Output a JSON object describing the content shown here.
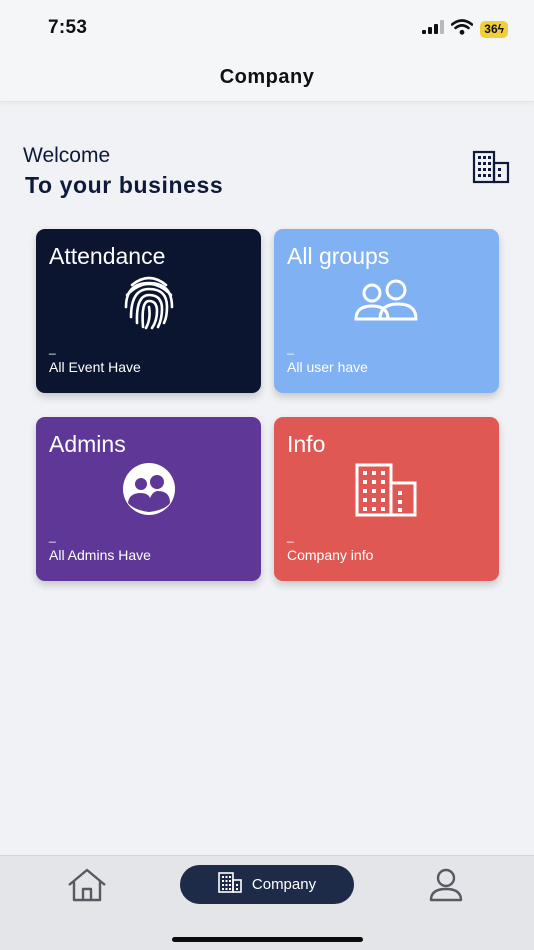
{
  "status": {
    "time": "7:53",
    "battery": "36"
  },
  "header": {
    "title": "Company"
  },
  "welcome": {
    "line1": "Welcome",
    "line2": "To your business"
  },
  "cards": [
    {
      "title": "Attendance",
      "dash": "_",
      "subtitle": "All Event Have",
      "color": "#0b1530",
      "icon": "fingerprint-icon"
    },
    {
      "title": "All groups",
      "dash": "_",
      "subtitle": "All user have",
      "color": "#80b1f2",
      "icon": "users-icon"
    },
    {
      "title": "Admins",
      "dash": "_",
      "subtitle": "All Admins Have",
      "color": "#5f3796",
      "icon": "admins-icon"
    },
    {
      "title": "Info",
      "dash": "_",
      "subtitle": "Company info",
      "color": "#df5853",
      "icon": "building-icon"
    }
  ],
  "tabbar": {
    "active_label": "Company",
    "active_color": "#1d2b48"
  }
}
